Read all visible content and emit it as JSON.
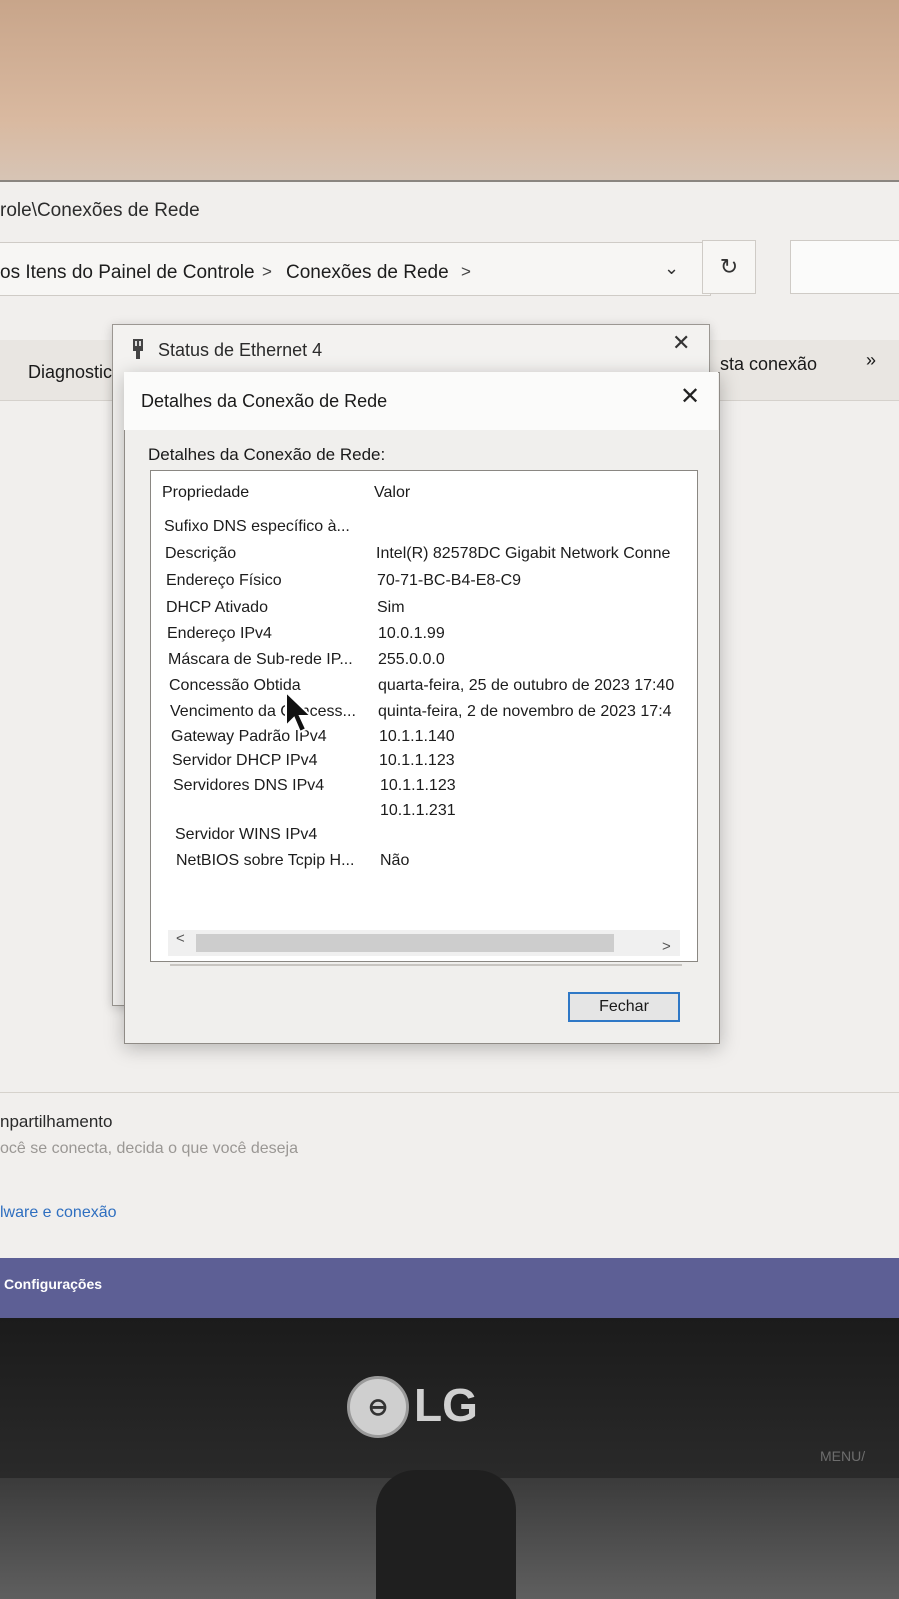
{
  "explorer": {
    "address_path": "role\\Conexões de Rede",
    "breadcrumb_1": "os Itens do Painel de Controle",
    "breadcrumb_sep": ">",
    "breadcrumb_2": "Conexões de Rede",
    "dropdown_glyph": "⌄",
    "refresh_glyph": "↻",
    "cmd_diagnose": "Diagnostic",
    "cmd_connection": "sta conexão",
    "cmd_more": "»"
  },
  "status_dialog": {
    "icon": "ethernet-plug-icon",
    "title": "Status de Ethernet 4",
    "close": "✕"
  },
  "details_dialog": {
    "title": "Detalhes da Conexão de Rede",
    "close": "✕",
    "group_label": "Detalhes da Conexão de Rede:",
    "columns": {
      "property": "Propriedade",
      "value": "Valor"
    },
    "rows": [
      {
        "property": "Sufixo DNS específico à...",
        "value": ""
      },
      {
        "property": "Descrição",
        "value": "Intel(R) 82578DC Gigabit Network Conne"
      },
      {
        "property": "Endereço Físico",
        "value": "70-71-BC-B4-E8-C9"
      },
      {
        "property": "DHCP Ativado",
        "value": "Sim"
      },
      {
        "property": "Endereço IPv4",
        "value": "10.0.1.99"
      },
      {
        "property": "Máscara de Sub-rede IP...",
        "value": "255.0.0.0"
      },
      {
        "property": "Concessão Obtida",
        "value": "quarta-feira, 25 de outubro de 2023 17:40"
      },
      {
        "property": "Vencimento da Concess...",
        "value": "quinta-feira, 2 de novembro de 2023 17:4"
      },
      {
        "property": "Gateway Padrão IPv4",
        "value": "10.1.1.140"
      },
      {
        "property": "Servidor DHCP IPv4",
        "value": "10.1.1.123"
      },
      {
        "property": "Servidores DNS IPv4",
        "value": "10.1.1.123"
      },
      {
        "property": "",
        "value": "10.1.1.231"
      },
      {
        "property": "Servidor WINS IPv4",
        "value": ""
      },
      {
        "property": "NetBIOS sobre Tcpip H...",
        "value": "Não"
      }
    ],
    "scroll_left": "<",
    "scroll_right": ">",
    "close_button": "Fechar"
  },
  "lower_panel": {
    "share_title": "npartilhamento",
    "share_desc": "ocê se conecta, decida o que você deseja",
    "link": "lware e conexão"
  },
  "taskbar": {
    "label": "Configurações"
  },
  "monitor": {
    "brand_logo": "LG",
    "brand_mark": "⊖",
    "menu_label": "MENU/"
  }
}
